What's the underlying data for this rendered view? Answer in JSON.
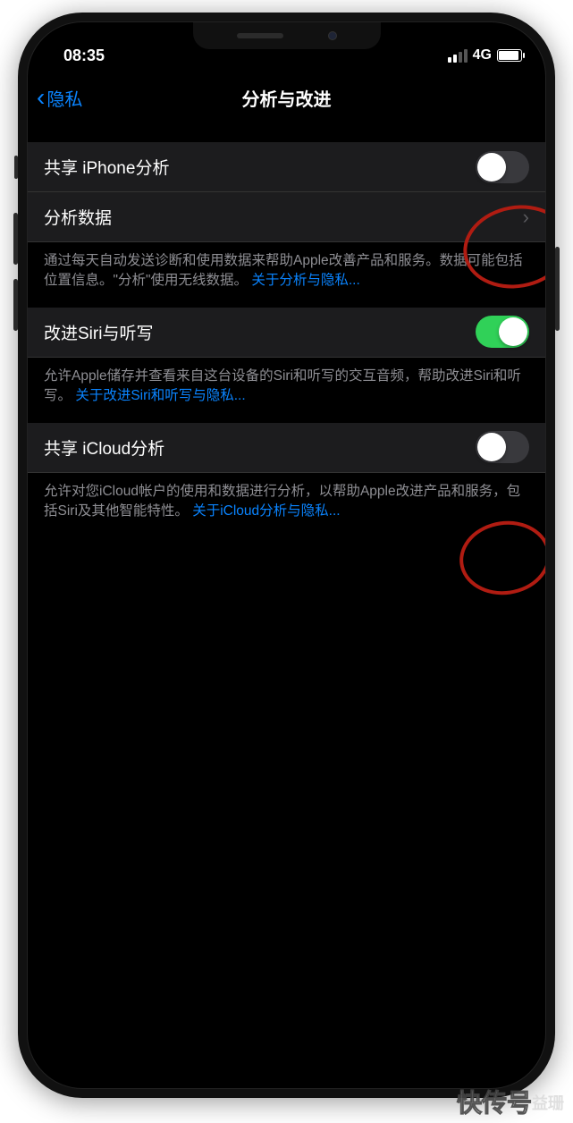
{
  "status": {
    "time": "08:35",
    "network": "4G"
  },
  "nav": {
    "back": "隐私",
    "title": "分析与改进"
  },
  "group1": {
    "row1": {
      "label": "共享 iPhone分析",
      "on": false
    },
    "row2": {
      "label": "分析数据"
    },
    "footer": {
      "text": "通过每天自动发送诊断和使用数据来帮助Apple改善产品和服务。数据可能包括位置信息。\"分析\"使用无线数据。",
      "link": "关于分析与隐私..."
    }
  },
  "group2": {
    "row1": {
      "label": "改进Siri与听写",
      "on": true
    },
    "footer": {
      "text": "允许Apple储存并查看来自这台设备的Siri和听写的交互音频，帮助改进Siri和听写。",
      "link": "关于改进Siri和听写与隐私..."
    }
  },
  "group3": {
    "row1": {
      "label": "共享 iCloud分析",
      "on": false
    },
    "footer": {
      "text": "允许对您iCloud帐户的使用和数据进行分析，以帮助Apple改进产品和服务，包括Siri及其他智能特性。",
      "link": "关于iCloud分析与隐私..."
    }
  },
  "watermark": {
    "main": "快传号",
    "sub": "益珊"
  }
}
